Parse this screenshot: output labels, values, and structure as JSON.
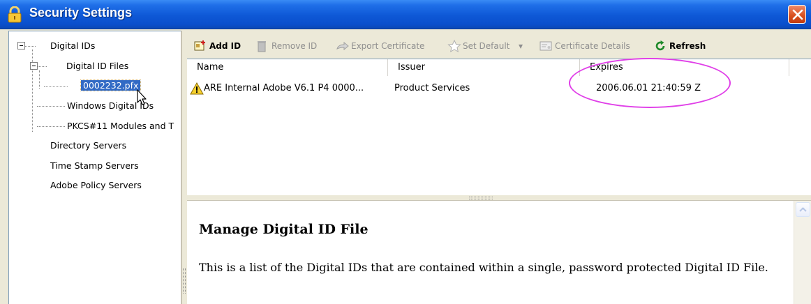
{
  "window": {
    "title": "Security Settings"
  },
  "tree": {
    "root_label": "Digital IDs",
    "files_label": "Digital ID Files",
    "selected_file": "0002232.pfx",
    "windows_label": "Windows Digital IDs",
    "pkcs_label": "PKCS#11 Modules and T",
    "directory_label": "Directory Servers",
    "timestamp_label": "Time Stamp Servers",
    "policy_label": "Adobe Policy Servers"
  },
  "toolbar": {
    "add_id": "Add ID",
    "remove_id": "Remove ID",
    "export_certificate": "Export Certificate",
    "set_default": "Set Default",
    "certificate_details": "Certificate Details",
    "refresh": "Refresh"
  },
  "list": {
    "columns": {
      "name": "Name",
      "issuer": "Issuer",
      "expires": "Expires"
    },
    "rows": [
      {
        "name": "ARE Internal Adobe V6.1 P4 0000...",
        "issuer": "Product Services",
        "expires": "2006.06.01 21:40:59 Z",
        "status_icon": "warning-icon"
      }
    ]
  },
  "description": {
    "title": "Manage Digital ID File",
    "body": "This is a list of the Digital IDs that are contained within a single, password protected Digital ID File."
  },
  "colors": {
    "title_bar": "#0e58d6",
    "selection": "#316ac5",
    "annotation": "#e040e8"
  }
}
